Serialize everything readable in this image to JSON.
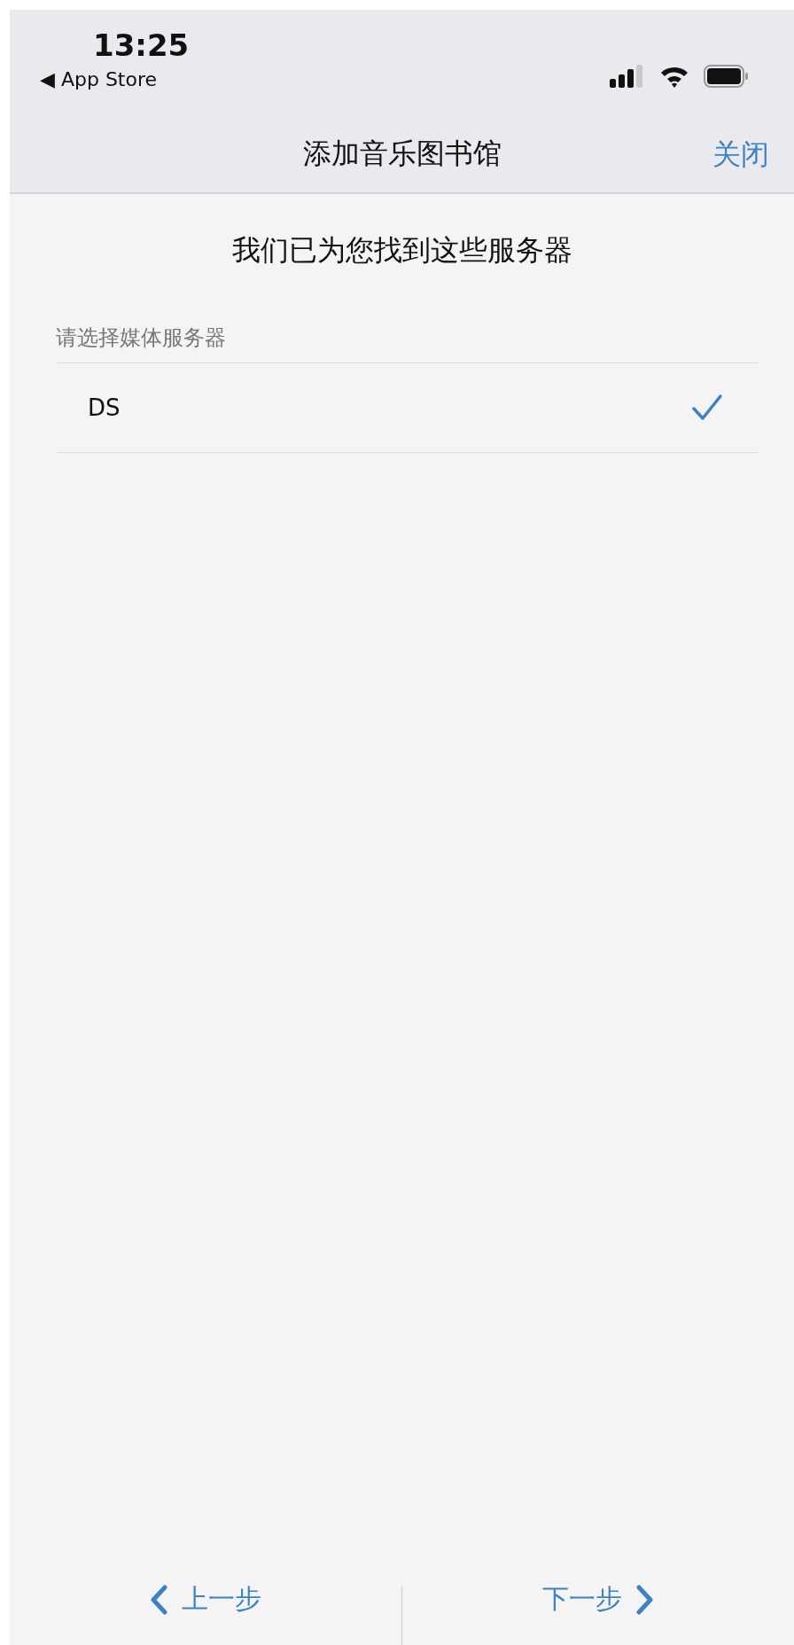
{
  "status_bar": {
    "time": "13:25",
    "back_app": "◀ App Store"
  },
  "nav": {
    "title": "添加音乐图书馆",
    "close": "关闭"
  },
  "heading": "我们已为您找到这些服务器",
  "section": {
    "label": "请选择媒体服务器",
    "items": [
      {
        "name": "DS",
        "selected": true
      }
    ]
  },
  "footer": {
    "back": "上一步",
    "next": "下一步"
  }
}
